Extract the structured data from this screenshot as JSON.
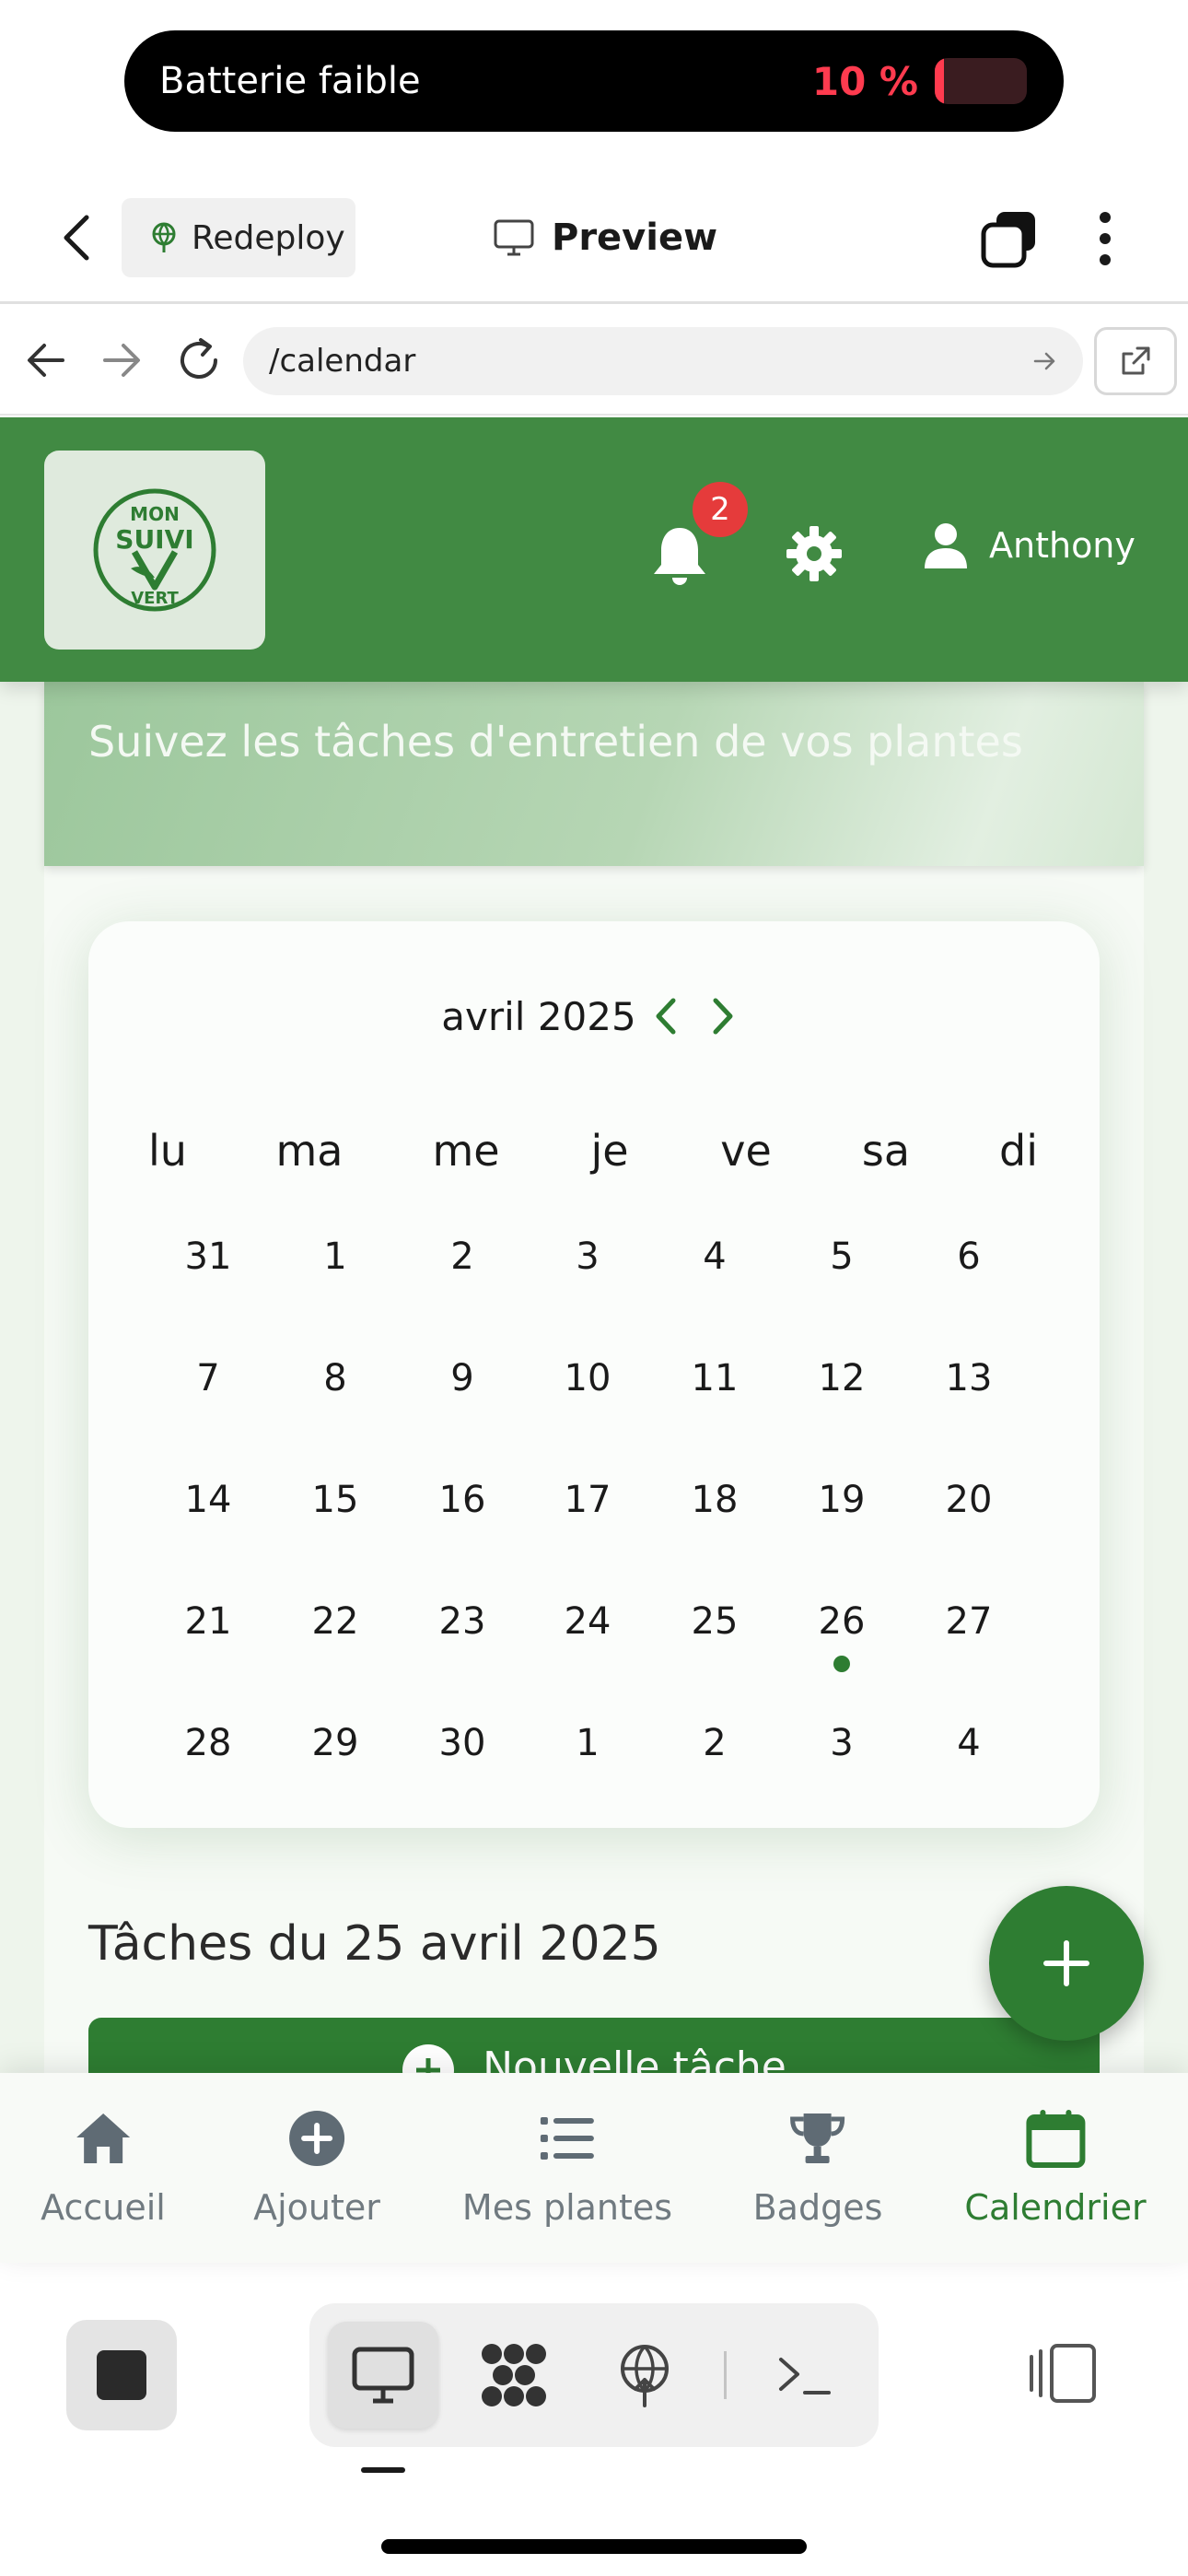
{
  "status": {
    "title": "Batterie faible",
    "battery_pct": "10 %",
    "battery_level": 0.1,
    "battery_color": "#ff3b4f"
  },
  "topbar": {
    "redeploy_label": "Redeploy",
    "preview_label": "Preview"
  },
  "browser": {
    "url": "/calendar"
  },
  "app": {
    "accent": "#2e7d32",
    "header_color": "#418a43",
    "logo_text": [
      "MON",
      "SUIVI",
      "VERT"
    ],
    "notification_count": "2",
    "user_name": "Anthony",
    "hero_subtitle": "Suivez les tâches d'entretien de vos plantes"
  },
  "calendar": {
    "month_label": "avril 2025",
    "weekdays": [
      "lu",
      "ma",
      "me",
      "je",
      "ve",
      "sa",
      "di"
    ],
    "weeks": [
      [
        "31",
        "1",
        "2",
        "3",
        "4",
        "5",
        "6"
      ],
      [
        "7",
        "8",
        "9",
        "10",
        "11",
        "12",
        "13"
      ],
      [
        "14",
        "15",
        "16",
        "17",
        "18",
        "19",
        "20"
      ],
      [
        "21",
        "22",
        "23",
        "24",
        "25",
        "26",
        "27"
      ],
      [
        "28",
        "29",
        "30",
        "1",
        "2",
        "3",
        "4"
      ]
    ],
    "days_with_tasks": [
      "26"
    ]
  },
  "tasks": {
    "title": "Tâches du 25 avril 2025",
    "new_task_label": "Nouvelle tâche"
  },
  "bottom_nav": [
    {
      "label": "Accueil",
      "icon": "home-icon",
      "active": false
    },
    {
      "label": "Ajouter",
      "icon": "add-circle-icon",
      "active": false
    },
    {
      "label": "Mes plantes",
      "icon": "list-icon",
      "active": false
    },
    {
      "label": "Badges",
      "icon": "trophy-icon",
      "active": false
    },
    {
      "label": "Calendrier",
      "icon": "calendar-icon",
      "active": true
    }
  ]
}
